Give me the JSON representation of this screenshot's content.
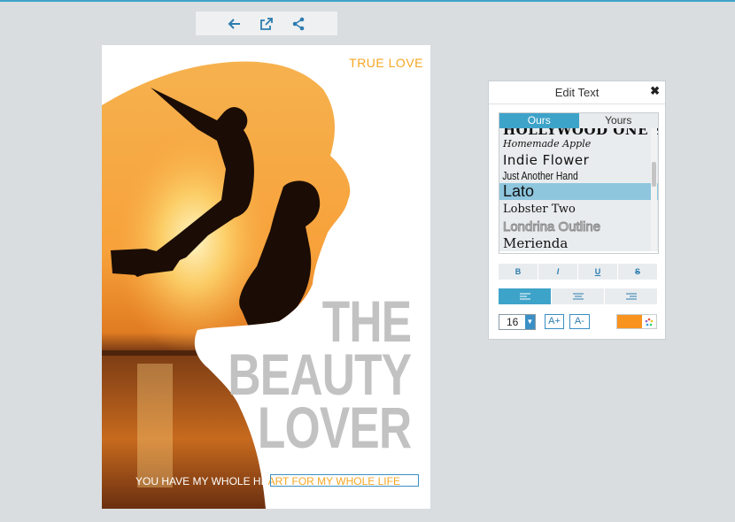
{
  "toolbar": {
    "buttons": [
      {
        "name": "back-button",
        "icon": "arrow-left-icon"
      },
      {
        "name": "open-external-button",
        "icon": "external-link-icon"
      },
      {
        "name": "share-button",
        "icon": "share-icon"
      }
    ]
  },
  "cover": {
    "tag": "TRUE LOVE",
    "title_lines": [
      "THE",
      "BEAUTY",
      "LOVER"
    ],
    "tagline_part1": "YOU HAVE MY WHOLE HE",
    "tagline_part2": "ART FOR MY WHOLE LIFE"
  },
  "edit_panel": {
    "title": "Edit Text",
    "close_label": "✖",
    "tabs": [
      "Ours",
      "Yours"
    ],
    "active_tab": "Ours",
    "fonts": [
      "HOLLYWOOD ONE SC",
      "Homemade Apple",
      "Indie Flower",
      "Just Another Hand",
      "Lato",
      "Lobster Two",
      "Londrina Outline",
      "Merienda"
    ],
    "selected_font": "Lato",
    "style_buttons": [
      "B",
      "I",
      "U",
      "S"
    ],
    "alignment": "left",
    "font_size": "16",
    "size_up": "A+",
    "size_down": "A-",
    "text_color": "#f7931e"
  },
  "colors": {
    "accent": "#3ea3c9",
    "cover_tag": "#f5a623",
    "title_gray": "#c2c2c2"
  }
}
